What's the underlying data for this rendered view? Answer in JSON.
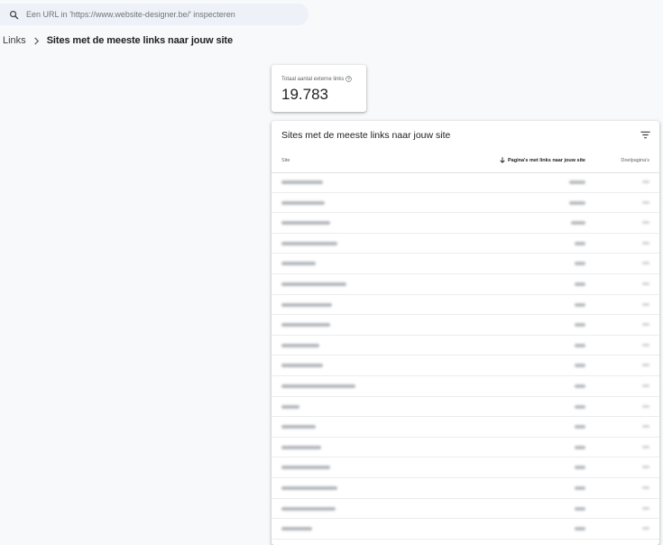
{
  "search": {
    "placeholder": "Een URL in 'https://www.website-designer.be/' inspecteren",
    "icon": "search-icon"
  },
  "breadcrumb": {
    "parent": "Links",
    "current": "Sites met de meeste links naar jouw site"
  },
  "metric": {
    "label": "Totaal aantal externe links",
    "value": "19.783",
    "help_icon": "help-circle-icon"
  },
  "table": {
    "title": "Sites met de meeste links naar jouw site",
    "filter_icon": "filter-icon",
    "columns": {
      "site": "Site",
      "pages": "Pagina's met links naar jouw site",
      "target": "Doelpagina's",
      "sort_icon": "arrow-down-icon"
    },
    "row_count": 18
  },
  "colors": {
    "background": "#f8f9fa",
    "search_background": "#eef1f8",
    "card": "#ffffff",
    "text": "#202124",
    "muted": "#5f6368"
  }
}
